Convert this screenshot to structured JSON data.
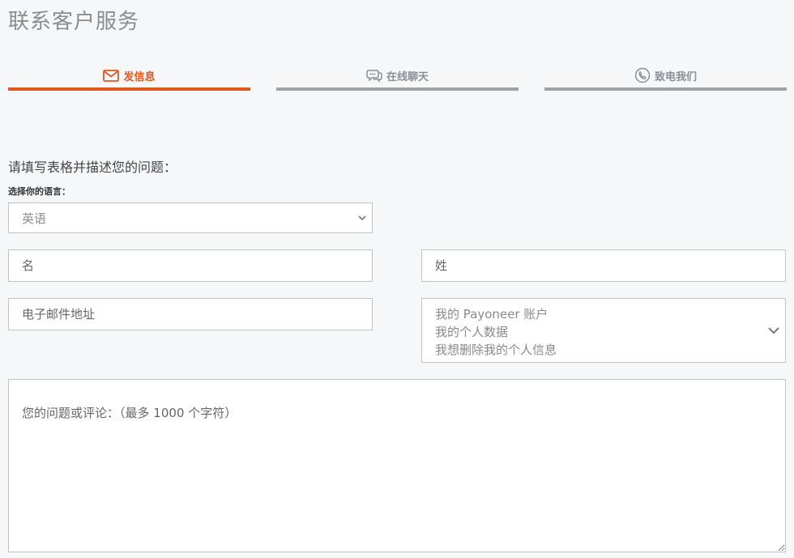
{
  "header": {
    "title": "联系客户服务"
  },
  "tabs": [
    {
      "label": "发信息",
      "icon": "envelope-icon",
      "active": true
    },
    {
      "label": "在线聊天",
      "icon": "chat-bubbles-icon",
      "active": false
    },
    {
      "label": "致电我们",
      "icon": "phone-icon",
      "active": false
    }
  ],
  "form": {
    "intro": "请填写表格并描述您的问题：",
    "language_label": "选择你的语言：",
    "language_value": "英语",
    "first_name_placeholder": "名",
    "last_name_placeholder": "姓",
    "email_placeholder": "电子邮件地址",
    "topic_options": [
      "我的 Payoneer 账户",
      "我的个人数据",
      "我想删除我的个人信息"
    ],
    "comment_placeholder": "您的问题或评论：（最多 1000 个字符）"
  },
  "colors": {
    "accent": "#e2561f",
    "inactive_tab": "#9ea3a8",
    "background": "#f6f7f9"
  }
}
